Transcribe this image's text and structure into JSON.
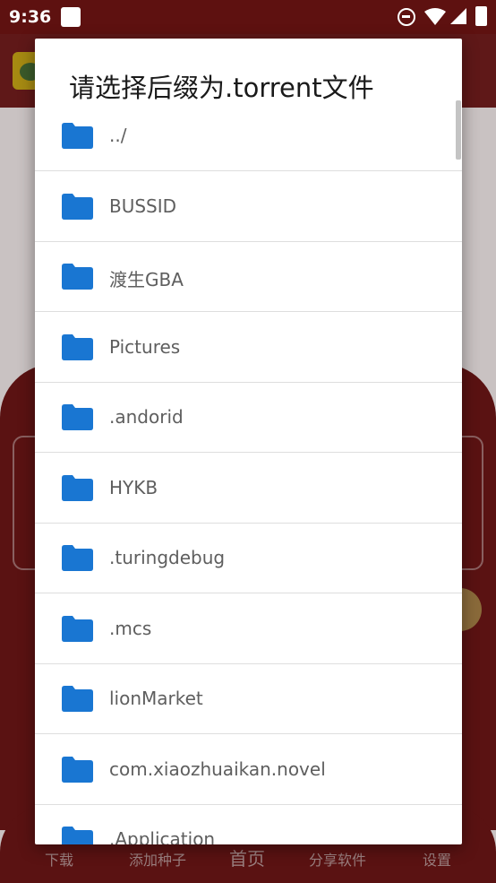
{
  "status_bar": {
    "time": "9:36"
  },
  "dialog": {
    "title": "请选择后缀为.torrent文件",
    "folders": [
      {
        "name": "../"
      },
      {
        "name": "BUSSID"
      },
      {
        "name": "渡生GBA"
      },
      {
        "name": "Pictures"
      },
      {
        "name": ".andorid"
      },
      {
        "name": "HYKB"
      },
      {
        "name": ".turingdebug"
      },
      {
        "name": ".mcs"
      },
      {
        "name": "lionMarket"
      },
      {
        "name": "com.xiaozhuaikan.novel"
      },
      {
        "name": ".Application"
      }
    ],
    "folder_icon": "folder-icon",
    "folder_color": "#1976d2"
  },
  "background_app": {
    "nav": {
      "download": "下载",
      "add_seed": "添加种子",
      "home": "首页",
      "share": "分享软件",
      "settings": "设置"
    }
  }
}
